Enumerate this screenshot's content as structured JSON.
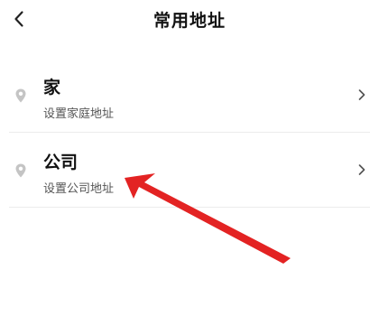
{
  "header": {
    "title": "常用地址",
    "back_icon": "chevron-left-icon"
  },
  "items": [
    {
      "title": "家",
      "subtitle": "设置家庭地址",
      "icon": "location-pin-icon"
    },
    {
      "title": "公司",
      "subtitle": "设置公司地址",
      "icon": "location-pin-icon"
    }
  ],
  "colors": {
    "text": "#111111",
    "subtext": "#555555",
    "divider": "#ececec",
    "icon": "#b8b8b8",
    "arrow": "#e32323"
  }
}
